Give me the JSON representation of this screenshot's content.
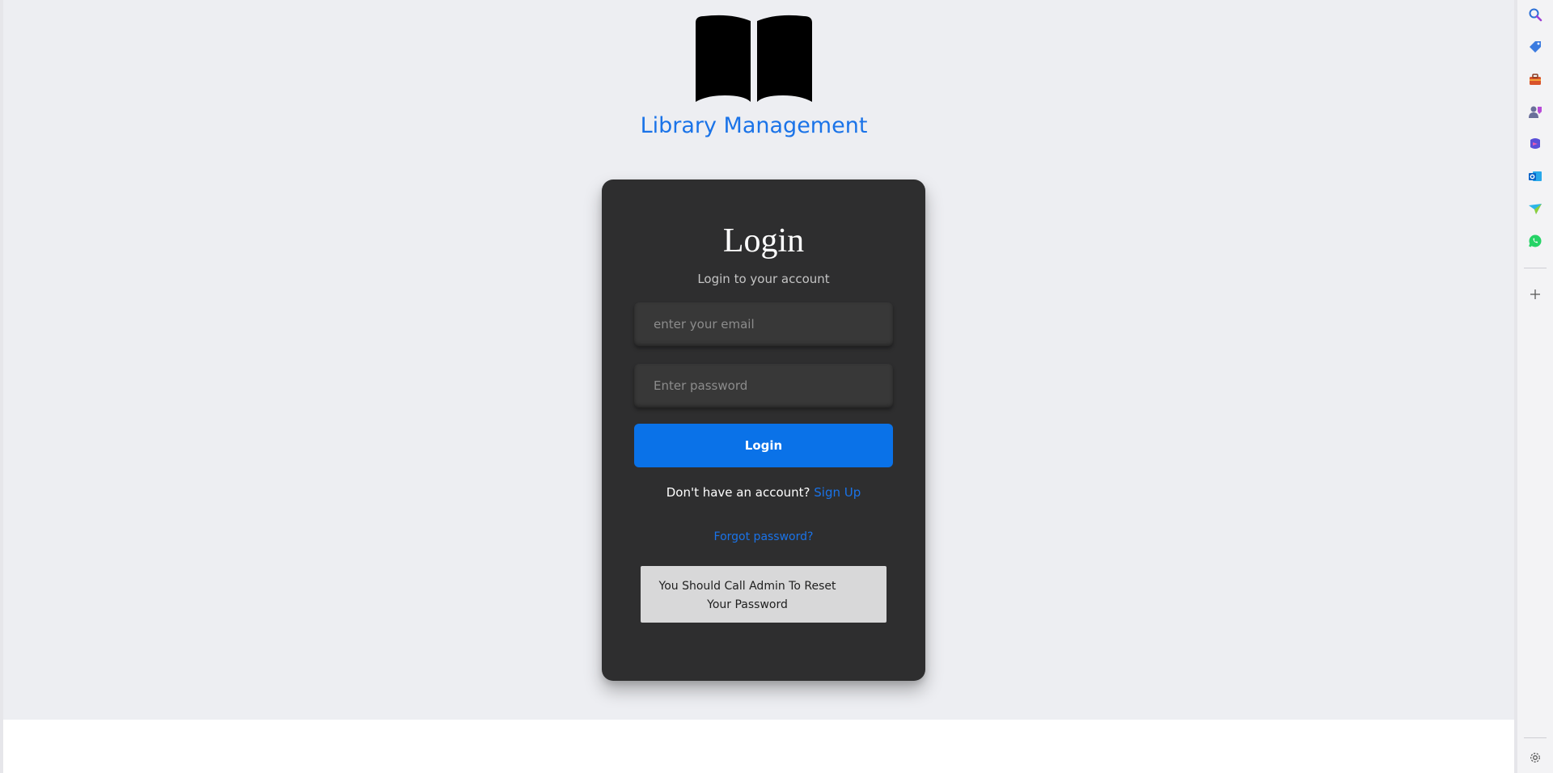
{
  "app": {
    "title": "Library Management",
    "logo_icon": "open-book-icon"
  },
  "login": {
    "heading": "Login",
    "subtitle": "Login to your account",
    "email_placeholder": "enter your email",
    "email_value": "",
    "password_placeholder": "Enter password",
    "password_value": "",
    "button_label": "Login",
    "signup_prompt": "Don't have an account?",
    "signup_link": "Sign Up",
    "forgot_link": "Forgot password?",
    "reset_message": "You Should Call Admin To Reset Your Password"
  },
  "colors": {
    "accent": "#1a73e8",
    "button": "#0a72e8",
    "card": "#2e2e2f",
    "page": "#edeef2"
  },
  "sidebar": {
    "icons": [
      "search-icon",
      "shopping-tag-icon",
      "toolbox-icon",
      "games-icon",
      "copilot-icon",
      "outlook-icon",
      "send-icon",
      "whatsapp-icon",
      "add-icon",
      "settings-icon"
    ]
  }
}
